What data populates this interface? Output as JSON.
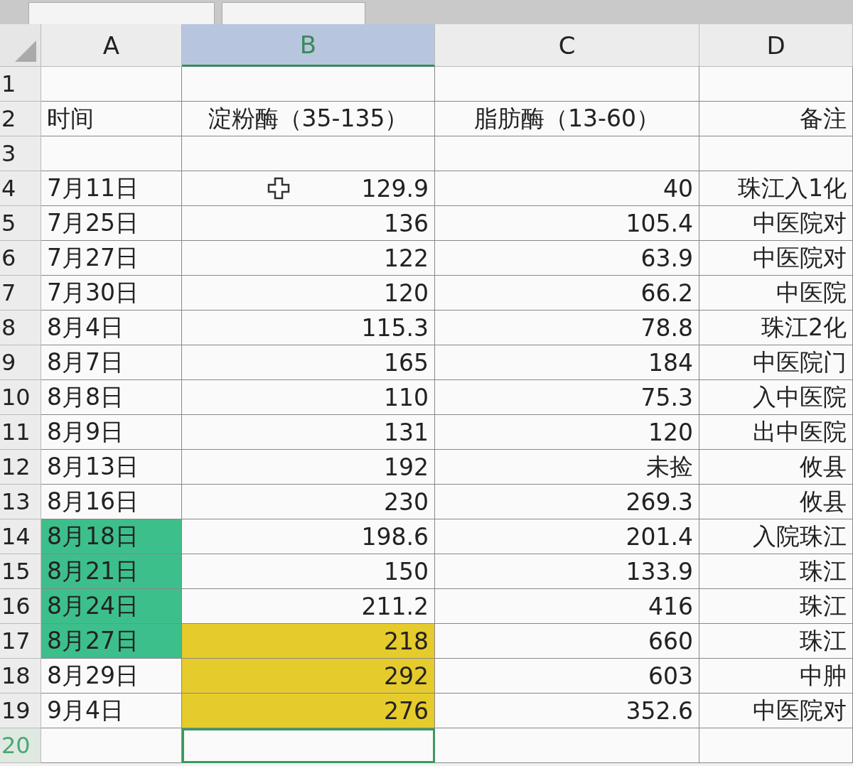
{
  "columns": [
    {
      "label": "A",
      "selected": false
    },
    {
      "label": "B",
      "selected": true
    },
    {
      "label": "C",
      "selected": false
    },
    {
      "label": "D",
      "selected": false
    }
  ],
  "rows": [
    {
      "number": "1",
      "selected": false,
      "cells": [
        {
          "text": ""
        },
        {
          "text": ""
        },
        {
          "text": ""
        },
        {
          "text": ""
        }
      ]
    },
    {
      "number": "2",
      "selected": false,
      "cells": [
        {
          "text": "时间"
        },
        {
          "text": "淀粉酶（35-135）"
        },
        {
          "text": "脂肪酶（13-60）"
        },
        {
          "text": "备注"
        }
      ]
    },
    {
      "number": "3",
      "selected": false,
      "cells": [
        {
          "text": ""
        },
        {
          "text": ""
        },
        {
          "text": ""
        },
        {
          "text": ""
        }
      ]
    },
    {
      "number": "4",
      "selected": false,
      "cells": [
        {
          "text": "7月11日"
        },
        {
          "text": "129.9",
          "cursor": true
        },
        {
          "text": "40"
        },
        {
          "text": "珠江入1化"
        }
      ]
    },
    {
      "number": "5",
      "selected": false,
      "cells": [
        {
          "text": "7月25日"
        },
        {
          "text": "136"
        },
        {
          "text": "105.4"
        },
        {
          "text": "中医院对"
        }
      ]
    },
    {
      "number": "6",
      "selected": false,
      "cells": [
        {
          "text": "7月27日"
        },
        {
          "text": "122"
        },
        {
          "text": "63.9"
        },
        {
          "text": "中医院对"
        }
      ]
    },
    {
      "number": "7",
      "selected": false,
      "cells": [
        {
          "text": "7月30日"
        },
        {
          "text": "120"
        },
        {
          "text": "66.2"
        },
        {
          "text": "中医院"
        }
      ]
    },
    {
      "number": "8",
      "selected": false,
      "cells": [
        {
          "text": "8月4日"
        },
        {
          "text": "115.3"
        },
        {
          "text": "78.8"
        },
        {
          "text": "珠江2化"
        }
      ]
    },
    {
      "number": "9",
      "selected": false,
      "cells": [
        {
          "text": "8月7日"
        },
        {
          "text": "165"
        },
        {
          "text": "184"
        },
        {
          "text": "中医院门"
        }
      ]
    },
    {
      "number": "10",
      "selected": false,
      "cells": [
        {
          "text": "8月8日"
        },
        {
          "text": "110"
        },
        {
          "text": "75.3"
        },
        {
          "text": "入中医院"
        }
      ]
    },
    {
      "number": "11",
      "selected": false,
      "cells": [
        {
          "text": "8月9日"
        },
        {
          "text": "131"
        },
        {
          "text": "120"
        },
        {
          "text": "出中医院"
        }
      ]
    },
    {
      "number": "12",
      "selected": false,
      "cells": [
        {
          "text": "8月13日"
        },
        {
          "text": "192"
        },
        {
          "text": "未捡"
        },
        {
          "text": "攸县"
        }
      ]
    },
    {
      "number": "13",
      "selected": false,
      "cells": [
        {
          "text": "8月16日"
        },
        {
          "text": "230"
        },
        {
          "text": "269.3"
        },
        {
          "text": "攸县"
        }
      ]
    },
    {
      "number": "14",
      "selected": false,
      "cells": [
        {
          "text": "8月18日",
          "color": "#3dbf8c"
        },
        {
          "text": "198.6"
        },
        {
          "text": "201.4"
        },
        {
          "text": "入院珠江"
        }
      ]
    },
    {
      "number": "15",
      "selected": false,
      "cells": [
        {
          "text": "8月21日",
          "color": "#3dbf8c"
        },
        {
          "text": "150"
        },
        {
          "text": "133.9"
        },
        {
          "text": "珠江"
        }
      ]
    },
    {
      "number": "16",
      "selected": false,
      "cells": [
        {
          "text": "8月24日",
          "color": "#3dbf8c"
        },
        {
          "text": "211.2"
        },
        {
          "text": "416"
        },
        {
          "text": "珠江"
        }
      ]
    },
    {
      "number": "17",
      "selected": false,
      "cells": [
        {
          "text": "8月27日",
          "color": "#3dbf8c"
        },
        {
          "text": "218",
          "color": "#e6cb2c"
        },
        {
          "text": "660"
        },
        {
          "text": "珠江"
        }
      ]
    },
    {
      "number": "18",
      "selected": false,
      "cells": [
        {
          "text": "8月29日"
        },
        {
          "text": "292",
          "color": "#e6cb2c"
        },
        {
          "text": "603"
        },
        {
          "text": "中肿"
        }
      ]
    },
    {
      "number": "19",
      "selected": false,
      "cells": [
        {
          "text": "9月4日"
        },
        {
          "text": "276",
          "color": "#e6cb2c"
        },
        {
          "text": "352.6"
        },
        {
          "text": "中医院对"
        }
      ]
    },
    {
      "number": "20",
      "selected": true,
      "cells": [
        {
          "text": ""
        },
        {
          "text": ""
        },
        {
          "text": ""
        },
        {
          "text": ""
        }
      ]
    }
  ]
}
